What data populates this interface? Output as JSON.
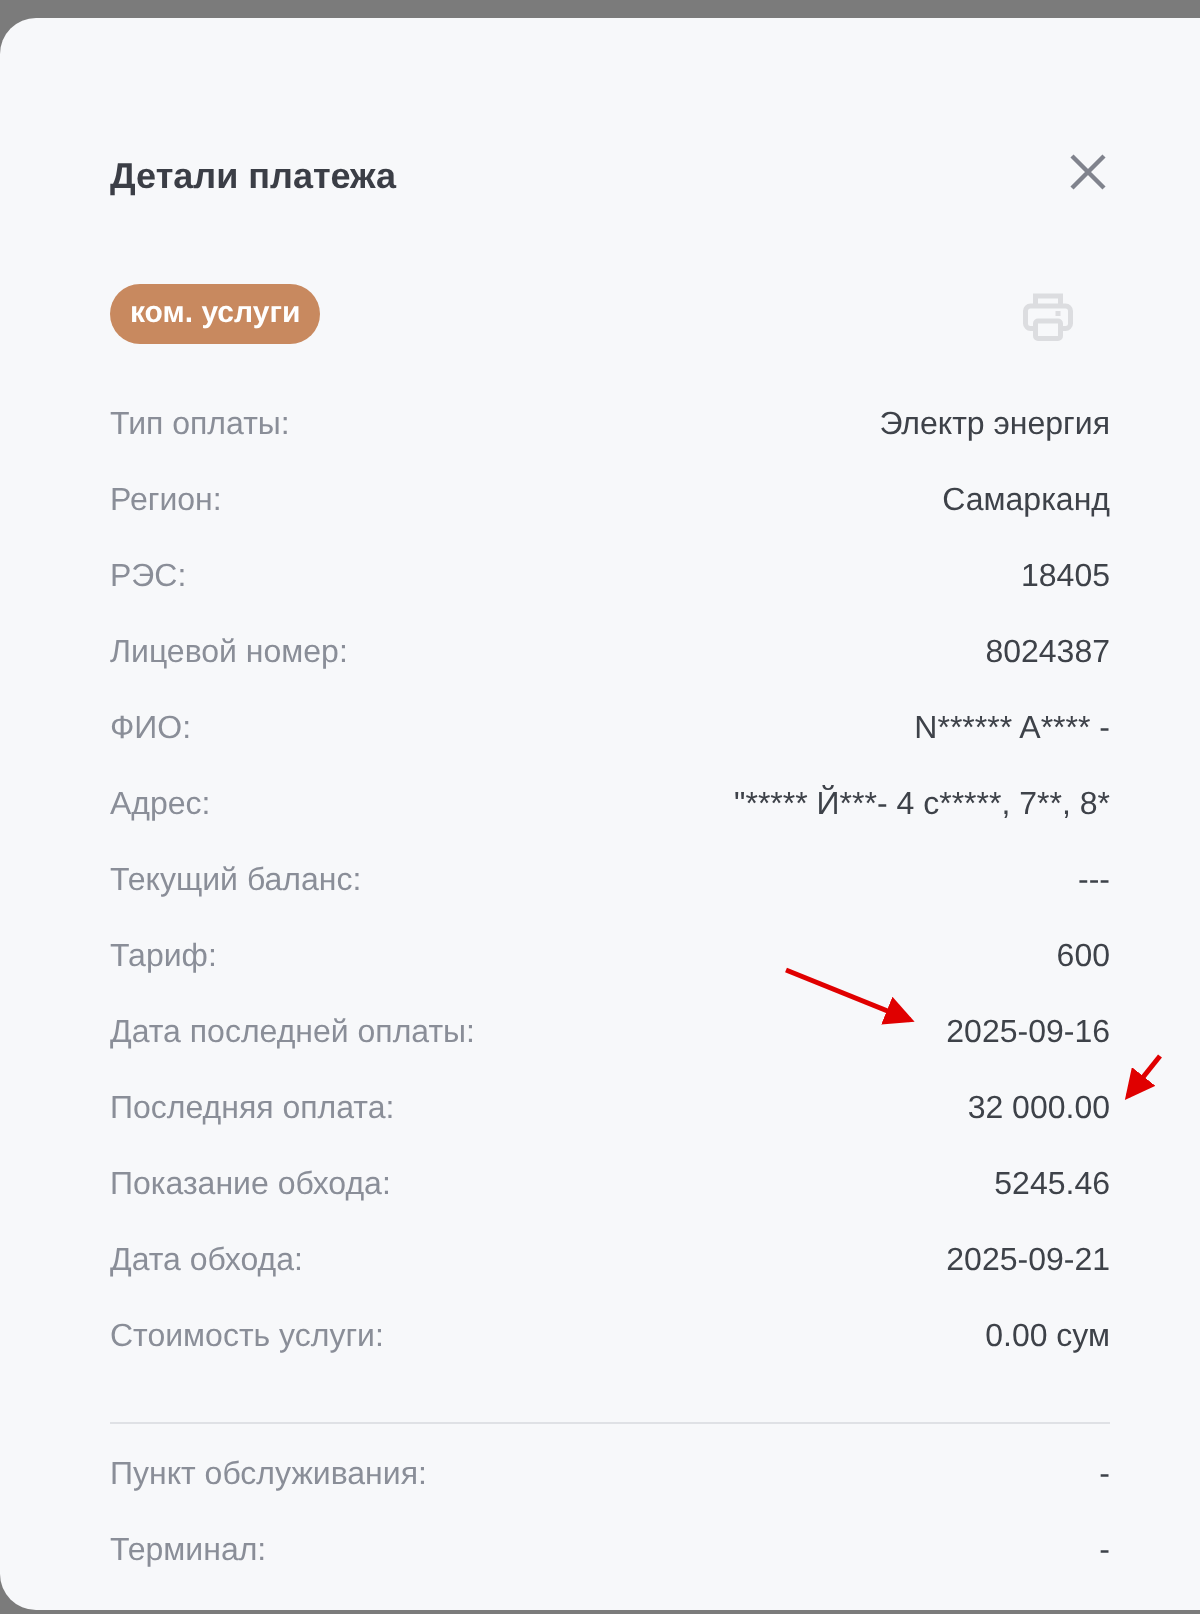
{
  "dialog": {
    "title": "Детали платежа"
  },
  "category": "ком. услуги",
  "details": [
    {
      "label": "Тип оплаты:",
      "value": "Электр энергия"
    },
    {
      "label": "Регион:",
      "value": "Самарканд"
    },
    {
      "label": "РЭС:",
      "value": "18405"
    },
    {
      "label": "Лицевой номер:",
      "value": "8024387"
    },
    {
      "label": "ФИО:",
      "value": "N****** A**** -"
    },
    {
      "label": "Адрес:",
      "value": "\"***** Й***- 4 с*****, 7**, 8*"
    },
    {
      "label": "Текущий баланс:",
      "value": "---"
    },
    {
      "label": "Тариф:",
      "value": "600"
    },
    {
      "label": "Дата последней оплаты:",
      "value": "2025-09-16"
    },
    {
      "label": "Последняя оплата:",
      "value": "32 000.00"
    },
    {
      "label": "Показание обхода:",
      "value": "5245.46"
    },
    {
      "label": "Дата обхода:",
      "value": "2025-09-21"
    },
    {
      "label": "Стоимость услуги:",
      "value": "0.00 сум"
    }
  ],
  "service": [
    {
      "label": "Пункт обслуживания:",
      "value": "-"
    },
    {
      "label": "Терминал:",
      "value": "-"
    }
  ]
}
